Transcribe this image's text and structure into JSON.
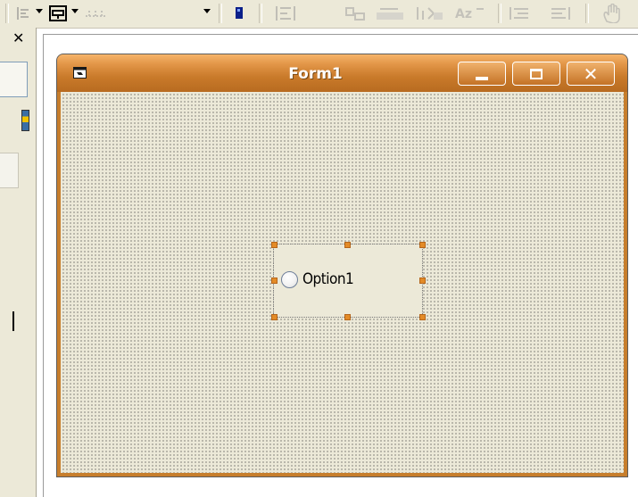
{
  "toolbar": {
    "items": [
      {
        "icon": "align-left-icon"
      },
      {
        "icon": "form-layout-icon"
      },
      {
        "icon": "size-grid-icon"
      },
      {
        "icon": "bring-to-front-icon"
      },
      {
        "icon": "align-grid-icon"
      },
      {
        "icon": "center-horizontally-icon"
      },
      {
        "icon": "make-same-width-icon"
      },
      {
        "icon": "make-same-height-icon"
      },
      {
        "icon": "font-size-icon"
      },
      {
        "icon": "indent-icon"
      },
      {
        "icon": "outdent-icon"
      },
      {
        "icon": "hand-icon"
      }
    ]
  },
  "left_panel": {
    "close_glyph": "✕"
  },
  "form": {
    "title": "Form1",
    "colors": {
      "titlebar": "#e39749",
      "client_background": "#ece9d8",
      "selection_handle": "#e38b27"
    },
    "controls": [
      {
        "type": "option-button",
        "label": "Option1",
        "selected_in_designer": true
      }
    ]
  }
}
